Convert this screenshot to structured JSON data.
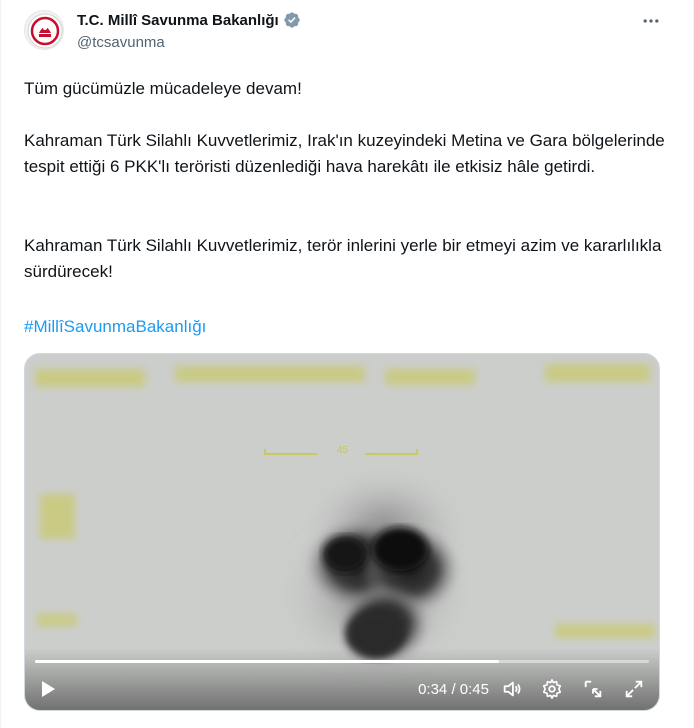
{
  "account": {
    "name": "T.C. Millî Savunma Bakanlığı",
    "handle": "@tcsavunma"
  },
  "tweet": {
    "line1": "Tüm gücümüzle mücadeleye devam!",
    "para2": "Kahraman Türk Silahlı Kuvvetlerimiz, Irak'ın kuzeyindeki Metina ve Gara bölgelerinde tespit ettiği 6 PKK'lı teröristi düzenlediği hava harekâtı ile etkisiz hâle getirdi.",
    "para3": "Kahraman Türk Silahlı Kuvvetlerimiz, terör inlerini yerle bir etmeyi azim ve kararlılıkla sürdürecek!",
    "hashtag": "#MillîSavunmaBakanlığı"
  },
  "video": {
    "current_time": "0:34",
    "separator": "/",
    "duration": "0:45",
    "progress_fraction": 0.755,
    "hud_readout": "45"
  },
  "icons": {
    "verified": "verified-badge-icon",
    "more": "more-options-icon",
    "play": "play-icon",
    "volume": "volume-icon",
    "settings": "gear-icon",
    "minimize": "minimize-icon",
    "fullscreen": "fullscreen-icon"
  },
  "colors": {
    "link": "#1d9bf0",
    "text": "#0f1419",
    "secondary": "#536471",
    "verified": "#829aab",
    "hud": "#c8c84a"
  }
}
